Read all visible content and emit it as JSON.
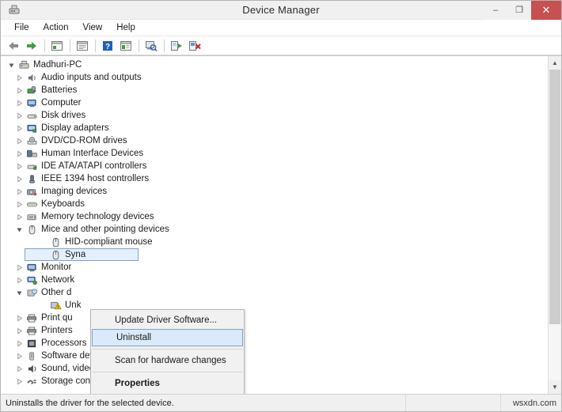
{
  "window": {
    "title": "Device Manager",
    "app_icon": "device-manager-icon",
    "minimize_label": "–",
    "maximize_label": "❐",
    "close_label": "✕"
  },
  "menubar": {
    "items": [
      {
        "label": "File"
      },
      {
        "label": "Action"
      },
      {
        "label": "View"
      },
      {
        "label": "Help"
      }
    ]
  },
  "toolbar": {
    "buttons": [
      {
        "name": "back-arrow-icon",
        "title": "Back"
      },
      {
        "name": "forward-arrow-icon",
        "title": "Forward"
      },
      {
        "name": "show-hide-console-tree-icon",
        "title": "Show/Hide Console Tree"
      },
      {
        "name": "properties-icon",
        "title": "Properties"
      },
      {
        "name": "help-icon",
        "title": "Help"
      },
      {
        "name": "view-devices-icon",
        "title": "View"
      },
      {
        "name": "scan-for-hardware-changes-icon",
        "title": "Scan for hardware changes"
      },
      {
        "name": "update-driver-icon",
        "title": "Update Driver Software"
      },
      {
        "name": "uninstall-device-icon",
        "title": "Uninstall"
      }
    ]
  },
  "tree": {
    "nodes": [
      {
        "label": "Madhuri-PC",
        "level": 0,
        "state": "expanded",
        "icon": "computer-icon"
      },
      {
        "label": "Audio inputs and outputs",
        "level": 1,
        "state": "collapsed",
        "icon": "speaker-icon"
      },
      {
        "label": "Batteries",
        "level": 1,
        "state": "collapsed",
        "icon": "battery-icon"
      },
      {
        "label": "Computer",
        "level": 1,
        "state": "collapsed",
        "icon": "monitor-icon"
      },
      {
        "label": "Disk drives",
        "level": 1,
        "state": "collapsed",
        "icon": "disk-icon"
      },
      {
        "label": "Display adapters",
        "level": 1,
        "state": "collapsed",
        "icon": "display-adapter-icon"
      },
      {
        "label": "DVD/CD-ROM drives",
        "level": 1,
        "state": "collapsed",
        "icon": "optical-drive-icon"
      },
      {
        "label": "Human Interface Devices",
        "level": 1,
        "state": "collapsed",
        "icon": "hid-icon"
      },
      {
        "label": "IDE ATA/ATAPI controllers",
        "level": 1,
        "state": "collapsed",
        "icon": "ide-controller-icon"
      },
      {
        "label": "IEEE 1394 host controllers",
        "level": 1,
        "state": "collapsed",
        "icon": "firewire-icon"
      },
      {
        "label": "Imaging devices",
        "level": 1,
        "state": "collapsed",
        "icon": "camera-icon"
      },
      {
        "label": "Keyboards",
        "level": 1,
        "state": "collapsed",
        "icon": "keyboard-icon"
      },
      {
        "label": "Memory technology devices",
        "level": 1,
        "state": "collapsed",
        "icon": "memory-icon"
      },
      {
        "label": "Mice and other pointing devices",
        "level": 1,
        "state": "expanded",
        "icon": "mouse-icon"
      },
      {
        "label": "HID-compliant mouse",
        "level": 2,
        "state": "leaf",
        "icon": "mouse-icon"
      },
      {
        "label": "Syna",
        "level": 2,
        "state": "leaf",
        "icon": "mouse-icon",
        "selected": true
      },
      {
        "label": "Monitor",
        "level": 1,
        "state": "collapsed",
        "icon": "monitor-icon"
      },
      {
        "label": "Network",
        "level": 1,
        "state": "collapsed",
        "icon": "network-icon"
      },
      {
        "label": "Other d",
        "level": 1,
        "state": "expanded",
        "icon": "unknown-device-icon"
      },
      {
        "label": "Unk",
        "level": 2,
        "state": "leaf",
        "icon": "warning-device-icon"
      },
      {
        "label": "Print qu",
        "level": 1,
        "state": "collapsed",
        "icon": "printer-icon"
      },
      {
        "label": "Printers",
        "level": 1,
        "state": "collapsed",
        "icon": "printer-icon"
      },
      {
        "label": "Processors",
        "level": 1,
        "state": "collapsed",
        "icon": "processor-icon"
      },
      {
        "label": "Software devices",
        "level": 1,
        "state": "collapsed",
        "icon": "software-device-icon"
      },
      {
        "label": "Sound, video and game controllers",
        "level": 1,
        "state": "collapsed",
        "icon": "sound-icon"
      },
      {
        "label": "Storage controllers",
        "level": 1,
        "state": "collapsed",
        "icon": "storage-controller-icon"
      }
    ],
    "expanded_glyph": "◢",
    "collapsed_glyph": "▷"
  },
  "context_menu": {
    "items": [
      {
        "label": "Update Driver Software...",
        "highlighted": false,
        "bold": false
      },
      {
        "label": "Uninstall",
        "highlighted": true,
        "bold": false
      },
      {
        "label": "Scan for hardware changes",
        "highlighted": false,
        "bold": false
      },
      {
        "label": "Properties",
        "highlighted": false,
        "bold": true
      }
    ]
  },
  "statusbar": {
    "message": "Uninstalls the driver for the selected device.",
    "middle": "",
    "watermark": "wsxdn.com"
  },
  "colors": {
    "close_button": "#c75050",
    "selection_fill": "#e4f0fb",
    "selection_border": "#7da2ce",
    "menu_highlight": "#dbeaf8",
    "window_chrome": "#f0f0f0"
  }
}
